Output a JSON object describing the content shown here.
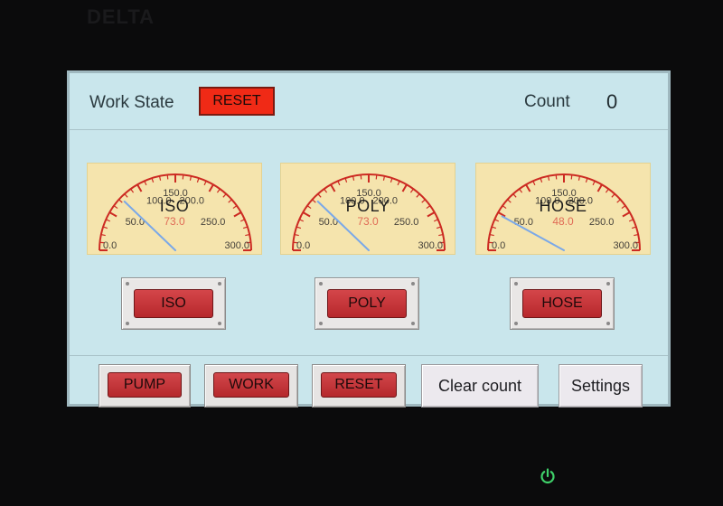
{
  "bezel": {
    "logo_text": "DELTA"
  },
  "header": {
    "work_state_label": "Work State",
    "work_state_value": "RESET",
    "count_label": "Count",
    "count_value": "0"
  },
  "gauges": [
    {
      "label": "ISO",
      "value_text": "73.0",
      "value": 73.0,
      "ticks": [
        "0.0",
        "50.0",
        "100.0",
        "150.0",
        "200.0",
        "250.0",
        "300.0"
      ]
    },
    {
      "label": "POLY",
      "value_text": "73.0",
      "value": 73.0,
      "ticks": [
        "0.0",
        "50.0",
        "100.0",
        "150.0",
        "200.0",
        "250.0",
        "300.0"
      ]
    },
    {
      "label": "HOSE",
      "value_text": "48.0",
      "value": 48.0,
      "ticks": [
        "0.0",
        "50.0",
        "100.0",
        "150.0",
        "200.0",
        "250.0",
        "300.0"
      ]
    }
  ],
  "gauge_range": [
    0,
    300
  ],
  "selector_buttons": {
    "iso": "ISO",
    "poly": "POLY",
    "hose": "HOSE"
  },
  "toolbar": {
    "pump": "PUMP",
    "work": "WORK",
    "reset": "RESET",
    "clear_count": "Clear count",
    "settings": "Settings"
  },
  "colors": {
    "screen_bg": "#c9e6ec",
    "gauge_face": "#f5e4ad",
    "scale_red": "#cc2a22",
    "needle": "#7aa8e8",
    "state_badge": "#f02a16",
    "button_red": "#c0373b",
    "power_led": "#3fd16a"
  },
  "icons": {
    "power": "power-icon"
  }
}
